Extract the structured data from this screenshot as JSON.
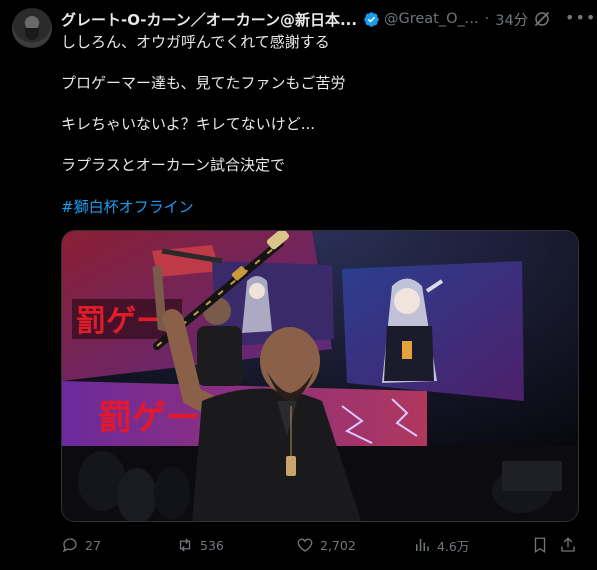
{
  "tweet": {
    "display_name": "グレート-O-カーン／オーカーン@新日本...",
    "handle": "@Great_O_...",
    "separator": "·",
    "time": "34分",
    "lines": [
      "ししろん、オウガ呼んでくれて感謝する",
      "プロゲーマー達も、見てたファンもご苦労",
      "キレちゃいないよ？キレてないけど...",
      "ラプラスとオーカーン試合決定で"
    ],
    "hashtag": "#獅白杯オフライン"
  },
  "media": {
    "banner_text_top": "罰ゲー",
    "banner_text_bottom": "罰ゲーム"
  },
  "actions": {
    "replies": "27",
    "reposts": "536",
    "likes": "2,702",
    "views": "4.6万"
  },
  "icons": {
    "verified": "verified-badge-icon",
    "grok": "grok-icon",
    "more": "more-icon",
    "reply": "reply-icon",
    "repost": "repost-icon",
    "like": "like-icon",
    "views": "views-icon",
    "bookmark": "bookmark-icon",
    "share": "share-icon"
  },
  "colors": {
    "background": "#000000",
    "text": "#e7e9ea",
    "secondary": "#71767b",
    "accent": "#1d9bf0"
  }
}
